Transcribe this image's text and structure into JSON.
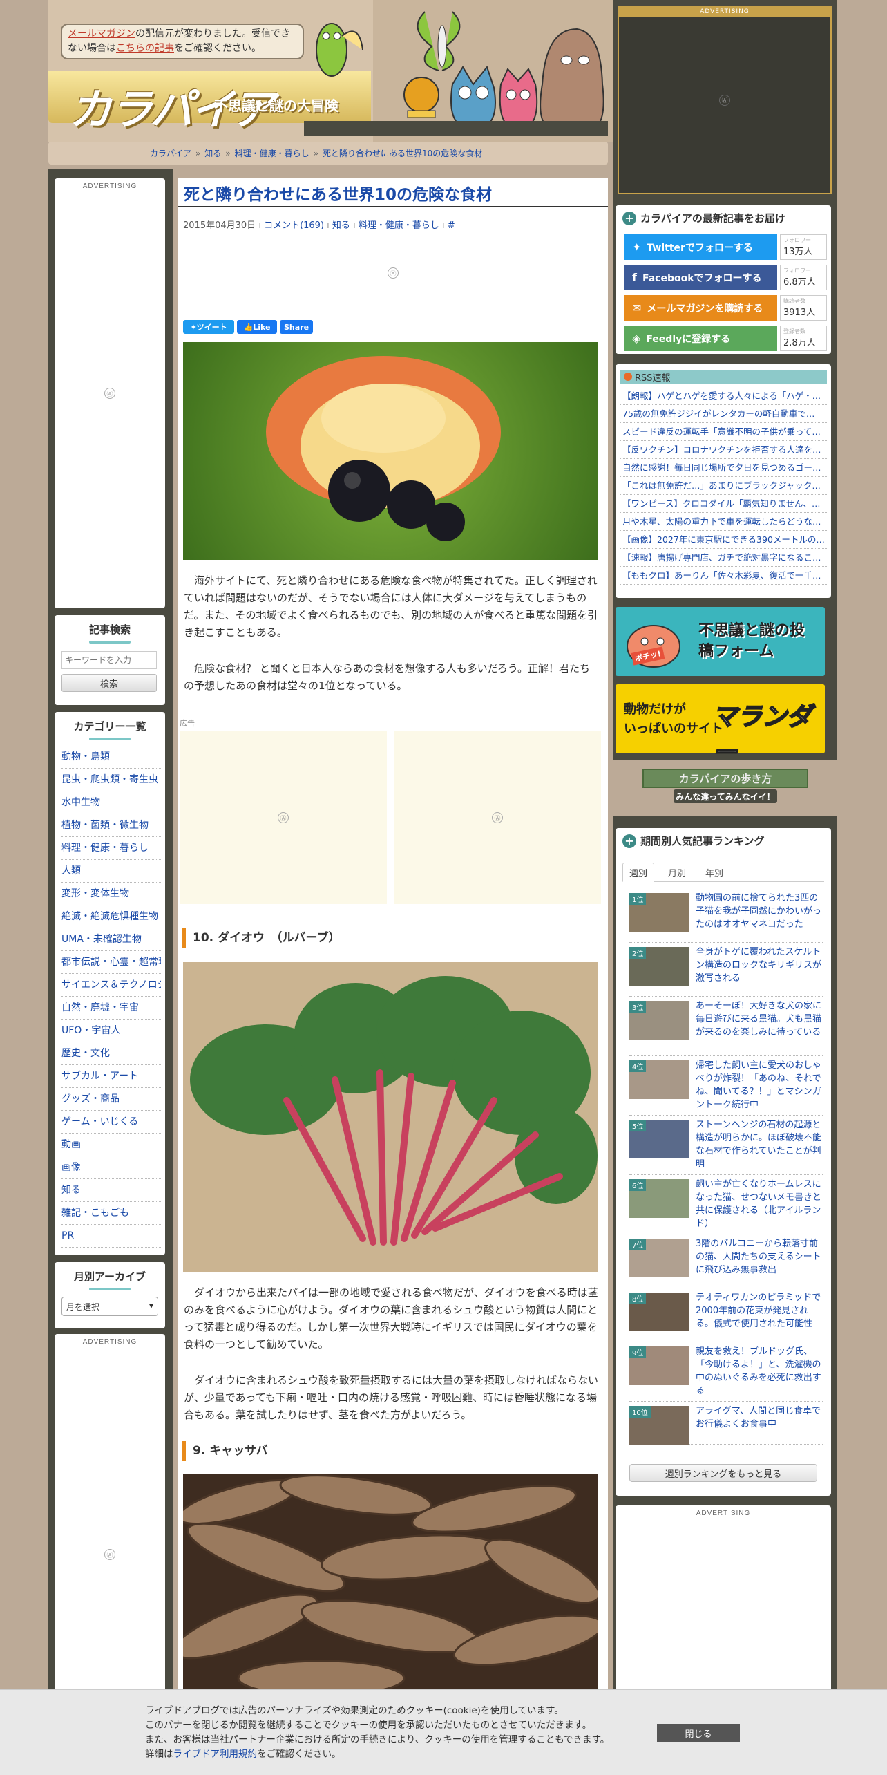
{
  "header": {
    "notice_pre": "メールマガジン",
    "notice_mid1": "の配信元が変わりました。受信できない場合は",
    "notice_link": "こちらの記事",
    "notice_post": "をご確認ください。",
    "logo": "カラパイア",
    "subtitle": "不思議と謎の大冒険"
  },
  "breadcrumb": [
    "カラパイア",
    "知る",
    "料理・健康・暮らし",
    "死と隣り合わせにある世界10の危険な食材"
  ],
  "advertising_label": "ADVERTISING",
  "ad_icon": "Ⓐ",
  "ad_small_label": "広告",
  "left": {
    "search_title": "記事検索",
    "search_placeholder": "キーワードを入力",
    "search_button": "検索",
    "category_title": "カテゴリー一覧",
    "categories": [
      "動物・鳥類",
      "昆虫・爬虫類・寄生虫",
      "水中生物",
      "植物・菌類・微生物",
      "料理・健康・暮らし",
      "人類",
      "変形・変体生物",
      "絶滅・絶滅危惧種生物",
      "UMA・未確認生物",
      "都市伝説・心霊・超常現象",
      "サイエンス＆テクノロジー",
      "自然・廃墟・宇宙",
      "UFO・宇宙人",
      "歴史・文化",
      "サブカル・アート",
      "グッズ・商品",
      "ゲーム・いじくる",
      "動画",
      "画像",
      "知る",
      "雑記・こもごも",
      "PR"
    ],
    "archive_title": "月別アーカイブ",
    "archive_select": "月を選択"
  },
  "article": {
    "title": "死と隣り合わせにある世界10の危険な食材",
    "date": "2015年04月30日",
    "comments": "コメント(169)",
    "cat1": "知る",
    "cat2": "料理・健康・暮らし",
    "hash": "#",
    "tweet": "ツイート",
    "like": "Like",
    "share": "Share",
    "p1": "海外サイトにて、死と隣り合わせにある危険な食べ物が特集されてた。正しく調理されていれば問題はないのだが、そうでない場合には人体に大ダメージを与えてしまうものだ。また、その地域でよく食べられるものでも、別の地域の人が食べると重篤な問題を引き起こすこともある。",
    "p2": "危険な食材？ と聞くと日本人ならあの食材を想像する人も多いだろう。正解！君たちの予想したあの食材は堂々の1位となっている。",
    "h10": "10. ダイオウ　（ルバーブ）",
    "p3": "ダイオウから出来たパイは一部の地域で愛される食べ物だが、ダイオウを食べる時は茎のみを食べるように心がけよう。ダイオウの葉に含まれるシュウ酸という物質は人間にとって猛毒と成り得るのだ。しかし第一次世界大戦時にイギリスでは国民にダイオウの葉を食料の一つとして勧めていた。",
    "p4": "ダイオウに含まれるシュウ酸を致死量摂取するには大量の葉を摂取しなければならないが、少量であっても下痢・嘔吐・口内の焼ける感覚・呼吸困難、時には昏睡状態になる場合もある。葉を試したりはせず、茎を食べた方がよいだろう。",
    "h9": "9. キャッサバ"
  },
  "right": {
    "follow_title": "カラパイアの最新記事をお届け",
    "follow": [
      {
        "label": "Twitterでフォローする",
        "small": "フォロワー",
        "count": "13万人",
        "color": "#1d9bf0"
      },
      {
        "label": "Facebookでフォローする",
        "small": "フォロワー",
        "count": "6.8万人",
        "color": "#3b5998"
      },
      {
        "label": "メールマガジンを購読する",
        "small": "購読者数",
        "count": "3913人",
        "color": "#e88a1a"
      },
      {
        "label": "Feedlyに登録する",
        "small": "登録者数",
        "count": "2.8万人",
        "color": "#5ba85b"
      }
    ],
    "rss_title": "RSS速報",
    "rss": [
      "【朗報】ハゲとハゲを愛する人々による「ハゲ・…",
      "75歳の無免許ジジイがレンタカーの軽自動車で…",
      "スピード違反の運転手「意識不明の子供が乗って…",
      "【反ワクチン】コロナワクチンを拒否する人達を…",
      "自然に感謝！毎日同じ場所で夕日を見つめるゴー…",
      "「これは無免許だ…」あまりにブラックジャック…",
      "【ワンピース】クロコダイル「覇気知りません、…",
      "月や木星、太陽の重力下で車を運転したらどうな…",
      "【画像】2027年に東京駅にできる390メートルの…",
      "【速報】唐揚げ専門店、ガチで絶対黒字になるこ…",
      "【ももクロ】あーりん「佐々木彩夏、復活で一手…"
    ],
    "banner1": "不思議と謎の投稿フォーム",
    "banner1_tag": "ポチッ!",
    "banner2a": "動物だけが",
    "banner2b": "いっぱいのサイト",
    "banner2c": "マランダー",
    "walk_title": "カラパイアの歩き方",
    "walk_sub": "みんな違ってみんなイイ！",
    "rank_title": "期間別人気記事ランキング",
    "tabs": [
      "週別",
      "月別",
      "年別"
    ],
    "ranking": [
      {
        "rank": "1位",
        "text": "動物園の前に捨てられた3匹の子猫を我が子同然にかわいがったのはオオヤマネコだった"
      },
      {
        "rank": "2位",
        "text": "全身がトゲに覆われたスケルトン構造のロックなキリギリスが激写される"
      },
      {
        "rank": "3位",
        "text": "あーそーぼ！大好きな犬の家に毎日遊びに来る黒猫。犬も黒猫が来るのを楽しみに待っている"
      },
      {
        "rank": "4位",
        "text": "帰宅した飼い主に愛犬のおしゃべりが炸裂！「あのね、それでね、聞いてる？！」とマシンガントーク続行中"
      },
      {
        "rank": "5位",
        "text": "ストーンヘンジの石材の起源と構造が明らかに。ほぼ破壊不能な石材で作られていたことが判明"
      },
      {
        "rank": "6位",
        "text": "飼い主が亡くなりホームレスになった猫、せつないメモ書きと共に保護される（北アイルランド）"
      },
      {
        "rank": "7位",
        "text": "3階のバルコニーから転落寸前の猫、人間たちの支えるシートに飛び込み無事救出"
      },
      {
        "rank": "8位",
        "text": "テオティワカンのピラミッドで2000年前の花束が発見される。儀式で使用された可能性"
      },
      {
        "rank": "9位",
        "text": "親友を救え！ブルドッグ氏、「今助けるよ！」と、洗濯機の中のぬいぐるみを必死に救出する"
      },
      {
        "rank": "10位",
        "text": "アライグマ、人間と同じ食卓でお行儀よくお食事中"
      }
    ],
    "more_button": "週別ランキングをもっと見る"
  },
  "cookie": {
    "line1": "ライブドアブログでは広告のパーソナライズや効果測定のためクッキー(cookie)を使用しています。",
    "line2": "このバナーを閉じるか閲覧を継続することでクッキーの使用を承認いただいたものとさせていただきます。",
    "line3": "また、お客様は当社パートナー企業における所定の手続きにより、クッキーの使用を管理することもできます。",
    "line4_pre": "詳細は",
    "line4_link": "ライブドア利用規約",
    "line4_post": "をご確認ください。",
    "close": "閉じる"
  }
}
